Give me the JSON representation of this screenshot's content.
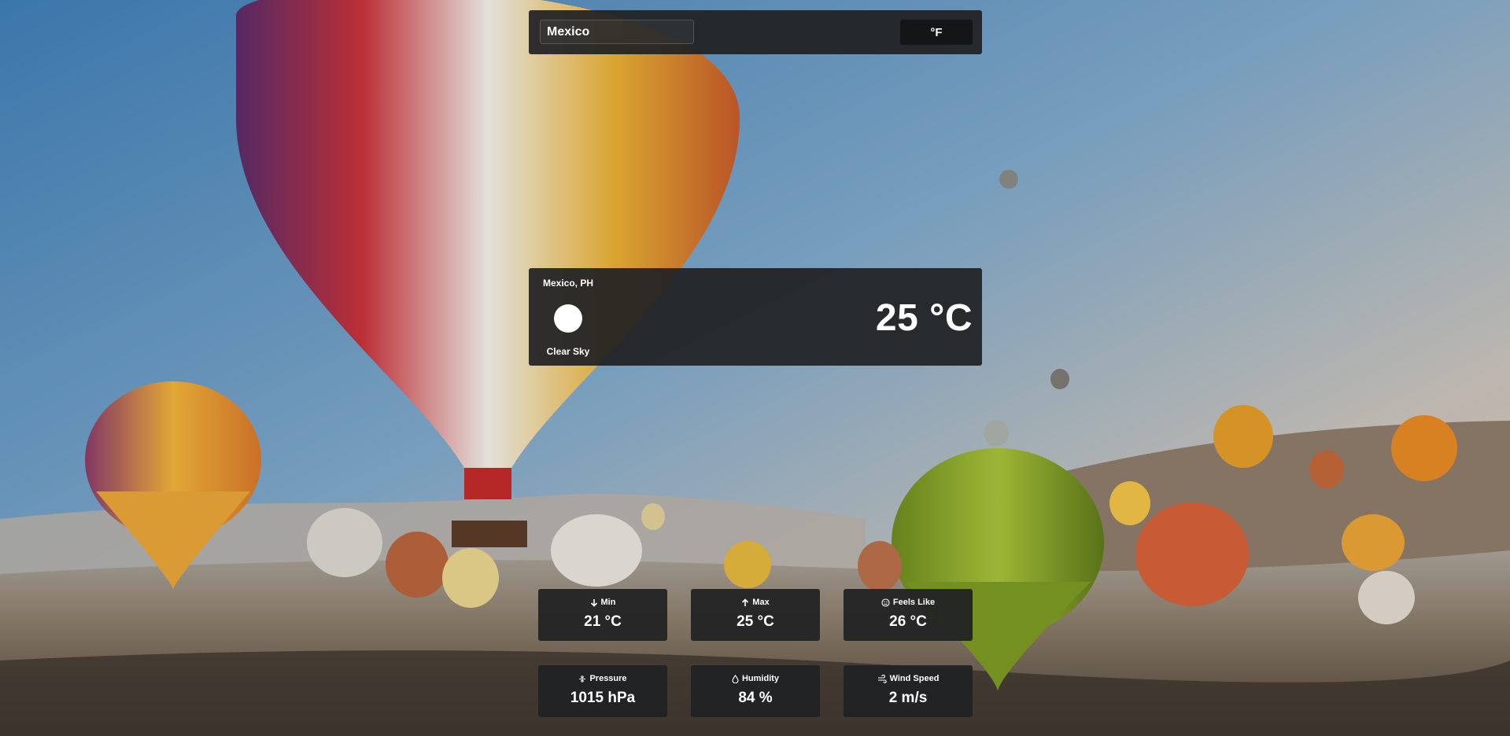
{
  "search": {
    "value": "Mexico"
  },
  "unit_toggle": {
    "label": "°F"
  },
  "current": {
    "location": "Mexico, PH",
    "condition": "Clear Sky",
    "temperature": "25 °C",
    "icon": "sun-icon"
  },
  "stats": {
    "min": {
      "label": "Min",
      "value": "21 °C",
      "icon": "arrow-down-icon"
    },
    "max": {
      "label": "Max",
      "value": "25 °C",
      "icon": "arrow-up-icon"
    },
    "feels_like": {
      "label": "Feels Like",
      "value": "26 °C",
      "icon": "smile-icon"
    },
    "pressure": {
      "label": "Pressure",
      "value": "1015 hPa",
      "icon": "pressure-icon"
    },
    "humidity": {
      "label": "Humidity",
      "value": "84 %",
      "icon": "droplet-icon"
    },
    "wind_speed": {
      "label": "Wind Speed",
      "value": "2 m/s",
      "icon": "wind-icon"
    }
  },
  "colors": {
    "panel": "#202124",
    "button": "#141516",
    "text": "#ffffff"
  }
}
